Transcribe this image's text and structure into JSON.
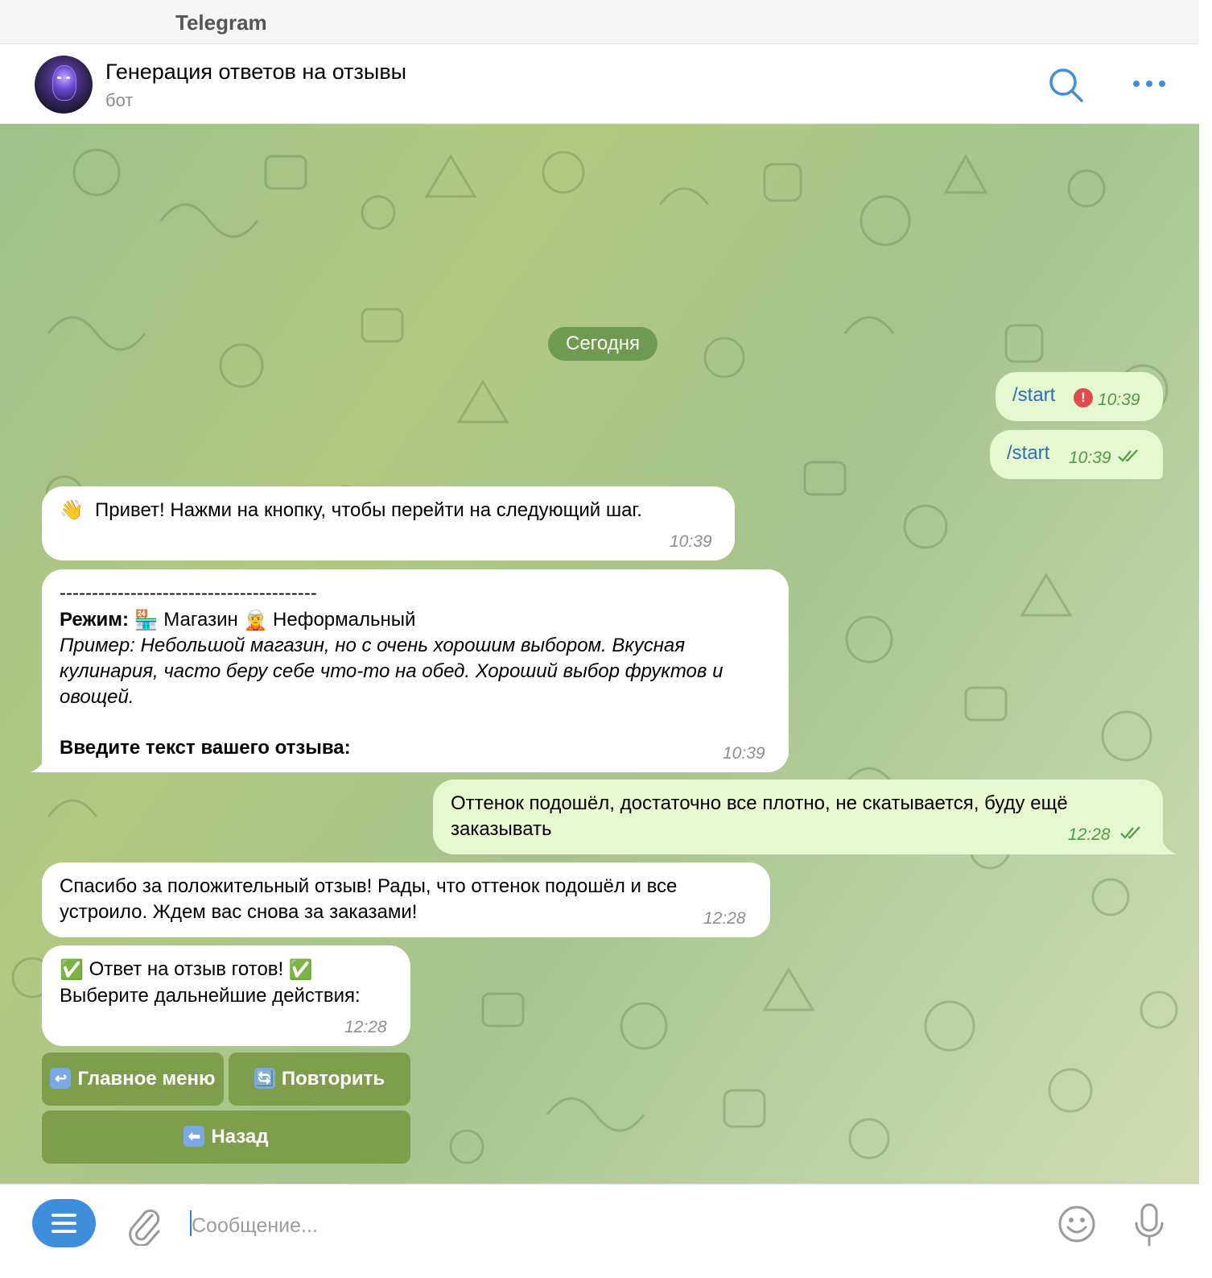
{
  "app": {
    "title": "Telegram"
  },
  "chat": {
    "title": "Генерация ответов на отзывы",
    "subtitle": "бот"
  },
  "date_separator": "Сегодня",
  "messages": [
    {
      "direction": "out",
      "text": "/start",
      "time": "10:39",
      "status": "error"
    },
    {
      "direction": "out",
      "text": "/start",
      "time": "10:39",
      "status": "read"
    },
    {
      "direction": "in",
      "emoji": "👋",
      "text": "Привет! Нажми на кнопку, чтобы перейти на следующий шаг.",
      "time": "10:39"
    },
    {
      "direction": "in",
      "divider": "----------------------------------------",
      "mode_label": "Режим:",
      "mode_emoji_1": "🏪",
      "mode_value_1": "Магазин",
      "mode_emoji_2": "🧝",
      "mode_value_2": "Неформальный",
      "example": "Пример: Небольшой магазин, но с очень хорошим выбором. Вкусная кулинария, часто беру себе что-то на обед. Хороший выбор фруктов и овощей.",
      "prompt": "Введите текст вашего отзыва:",
      "time": "10:39"
    },
    {
      "direction": "out",
      "text": "Оттенок подошёл, достаточно все плотно, не скатывается, буду ещё заказывать",
      "time": "12:28",
      "status": "read"
    },
    {
      "direction": "in",
      "text": "Спасибо за положительный отзыв! Рады, что оттенок подошёл и все устроило. Ждем вас снова за заказами!",
      "time": "12:28"
    },
    {
      "direction": "in",
      "emoji": "✅",
      "line1": "Ответ на отзыв готов!",
      "line2": "Выберите дальнейшие действия:",
      "time": "12:28"
    }
  ],
  "keyboard": {
    "main_menu": "Главное меню",
    "repeat": "Повторить",
    "back": "Назад"
  },
  "composer": {
    "placeholder": "Сообщение..."
  },
  "colors": {
    "accent": "#3e8edb",
    "out_bubble": "#e6f8cf",
    "in_bubble": "#ffffff",
    "date_pill": "#6e9a52",
    "keyboard_button": "#7e9e4c",
    "error": "#e24b4b"
  },
  "icons": {
    "search": "search-icon",
    "more": "more-icon",
    "attach": "paperclip-icon",
    "emoji": "smiley-icon",
    "mic": "microphone-icon",
    "menu": "menu-icon"
  }
}
